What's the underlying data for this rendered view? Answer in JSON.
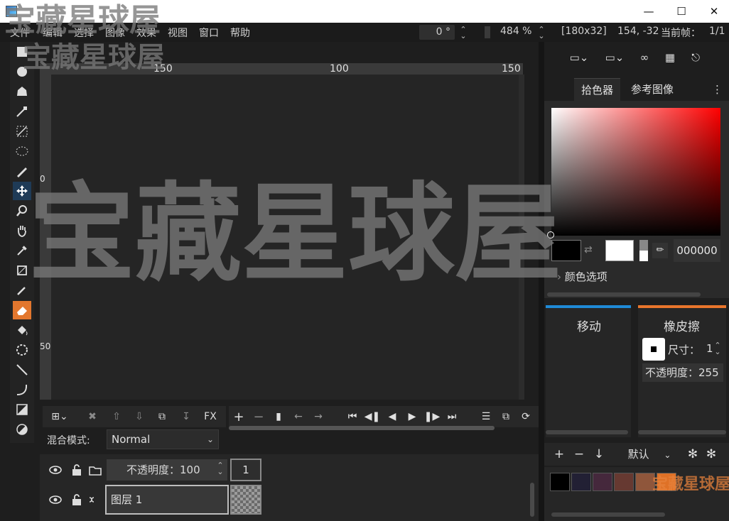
{
  "menu": [
    "文件",
    "编辑",
    "选择",
    "图像",
    "效果",
    "视图",
    "窗口",
    "帮助"
  ],
  "statusbar": {
    "rotation": "0 °",
    "zoom": "484 %",
    "selection_size": "[180x32]",
    "cursor_pos": "154, -32",
    "frame_label": "当前帧：",
    "frame_value": "1/1"
  },
  "ruler": {
    "top_labels": [
      "150",
      "100",
      "150"
    ],
    "left_labels": [
      "0",
      "50"
    ]
  },
  "layer_panel": {
    "blend_label": "混合模式:",
    "blend_value": "Normal",
    "fx_label": "FX",
    "opacity_label": "不透明度：",
    "opacity_value": "100",
    "frame_number": "1",
    "layer_name": "图层 1"
  },
  "right_panel": {
    "tabs": [
      "拾色器",
      "参考图像"
    ],
    "hex_value": "000000",
    "color_options": "颜色选项",
    "move_tool_label": "移动",
    "eraser_tool_label": "橡皮擦",
    "size_label": "尺寸：",
    "size_value": "1",
    "eraser_opacity_label": "不透明度：",
    "eraser_opacity_value": "255",
    "palette_name": "默认"
  },
  "colors": {
    "move_accent": "#1f8ad6",
    "eraser_accent": "#e8752c",
    "palette": [
      "#000000",
      "#222034",
      "#45283c",
      "#663931",
      "#8f563b",
      "#df7126"
    ]
  },
  "watermark": "宝藏星球屋"
}
